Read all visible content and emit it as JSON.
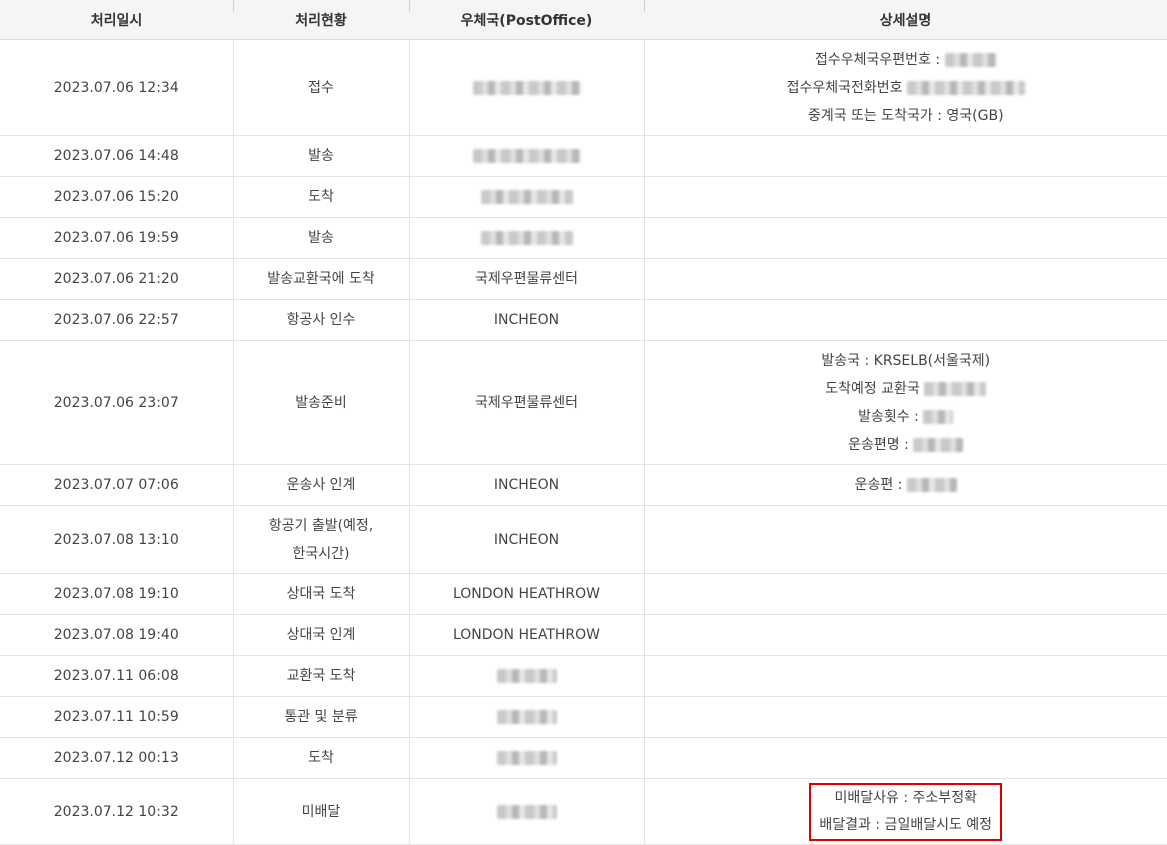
{
  "headers": {
    "date": "처리일시",
    "status": "처리현황",
    "office": "우체국(PostOffice)",
    "detail": "상세설명"
  },
  "rows": [
    {
      "date": "2023.07.06 12:34",
      "status": "접수"
    },
    {
      "date": "2023.07.06 14:48",
      "status": "발송"
    },
    {
      "date": "2023.07.06 15:20",
      "status": "도착"
    },
    {
      "date": "2023.07.06 19:59",
      "status": "발송"
    },
    {
      "date": "2023.07.06 21:20",
      "status": "발송교환국에 도착",
      "office": "국제우편물류센터"
    },
    {
      "date": "2023.07.06 22:57",
      "status": "항공사 인수",
      "office": "INCHEON"
    },
    {
      "date": "2023.07.06 23:07",
      "status": "발송준비",
      "office": "국제우편물류센터"
    },
    {
      "date": "2023.07.07 07:06",
      "status": "운송사 인계",
      "office": "INCHEON"
    },
    {
      "date": "2023.07.08 13:10",
      "status_line1": "항공기 출발(예정,",
      "status_line2": "한국시간)",
      "office": "INCHEON"
    },
    {
      "date": "2023.07.08 19:10",
      "status": "상대국 도착",
      "office": "LONDON HEATHROW"
    },
    {
      "date": "2023.07.08 19:40",
      "status": "상대국 인계",
      "office": "LONDON HEATHROW"
    },
    {
      "date": "2023.07.11 06:08",
      "status": "교환국 도착"
    },
    {
      "date": "2023.07.11 10:59",
      "status": "통관 및 분류"
    },
    {
      "date": "2023.07.12 00:13",
      "status": "도착"
    },
    {
      "date": "2023.07.12 10:32",
      "status": "미배달"
    }
  ],
  "details": {
    "receipt_postcode": "접수우체국우편번호 :",
    "receipt_phone": "접수우체국전화번호",
    "destination": "중계국 또는 도착국가 : 영국(GB)",
    "sending_country": "발송국 : KRSELB(서울국제)",
    "arrival_exchange": "도착예정 교환국",
    "send_count": "발송횟수 :",
    "flight_name": "운송편명 :",
    "transport": "운송편 :",
    "undelivered_reason": "미배달사유 : 주소부정확",
    "delivery_result": "배달결과 : 금일배달시도 예정"
  },
  "colors": {
    "highlight_border": "#e00000",
    "header_bg": "#f5f5f5"
  }
}
